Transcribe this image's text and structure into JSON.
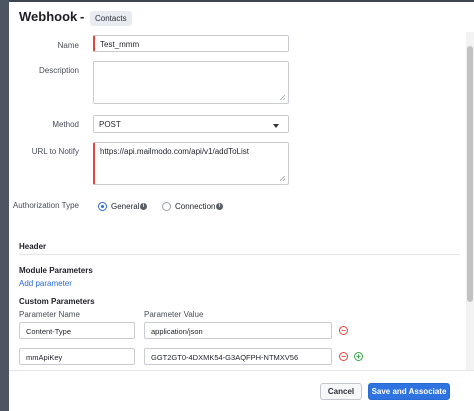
{
  "header": {
    "title": "Webhook",
    "separator": "-",
    "module_tag": "Contacts"
  },
  "form": {
    "name_label": "Name",
    "name_value": "Test_mmm",
    "description_label": "Description",
    "description_value": "",
    "method_label": "Method",
    "method_value": "POST",
    "url_label": "URL to Notify",
    "url_value": "https://api.mailmodo.com/api/v1/addToList",
    "auth_label": "Authorization Type",
    "auth_options": [
      {
        "label": "General",
        "selected": true
      },
      {
        "label": "Connection",
        "selected": false
      }
    ]
  },
  "sections": {
    "header_title": "Header",
    "module_params_title": "Module Parameters",
    "add_parameter": "Add parameter",
    "custom_params_title": "Custom Parameters",
    "col_param_name": "Parameter Name",
    "col_param_value": "Parameter Value"
  },
  "custom_params": [
    {
      "name": "Content-Type",
      "value": "application/json"
    },
    {
      "name": "mmApiKey",
      "value": "GGT2GT0-4DXMK54-G3AQFPH-NTMXV56"
    }
  ],
  "footer": {
    "cancel": "Cancel",
    "save": "Save and Associate"
  },
  "colors": {
    "accent": "#2f73e0",
    "required": "#e2453b",
    "add": "#37a84a"
  },
  "icons": {
    "info": "info-icon",
    "remove": "minus-circle-icon",
    "add": "plus-circle-icon",
    "dropdown": "chevron-down-icon"
  }
}
